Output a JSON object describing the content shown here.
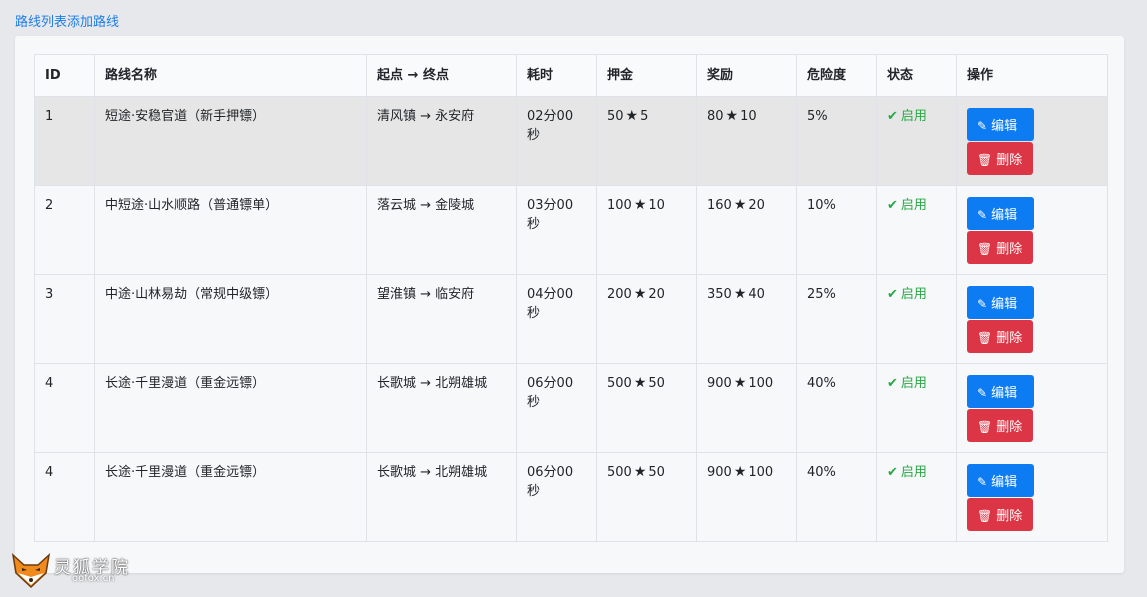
{
  "nav": {
    "link_list": "路线列表",
    "link_add": "添加路线"
  },
  "table": {
    "headers": {
      "id": "ID",
      "name": "路线名称",
      "route": "起点 → 终点",
      "duration": "耗时",
      "deposit": "押金",
      "reward": "奖励",
      "risk": "危险度",
      "status": "状态",
      "actions": "操作"
    },
    "rows": [
      {
        "id": "1",
        "name": "短途·安稳官道（新手押镖）",
        "route": "清风镇 → 永安府",
        "duration": "02分00秒",
        "deposit": "50",
        "deposit_stars": "5",
        "reward": "80",
        "reward_stars": "10",
        "risk": "5%",
        "status": "启用"
      },
      {
        "id": "2",
        "name": "中短途·山水顺路（普通镖单）",
        "route": "落云城 → 金陵城",
        "duration": "03分00秒",
        "deposit": "100",
        "deposit_stars": "10",
        "reward": "160",
        "reward_stars": "20",
        "risk": "10%",
        "status": "启用"
      },
      {
        "id": "3",
        "name": "中途·山林易劫（常规中级镖）",
        "route": "望淮镇 → 临安府",
        "duration": "04分00秒",
        "deposit": "200",
        "deposit_stars": "20",
        "reward": "350",
        "reward_stars": "40",
        "risk": "25%",
        "status": "启用"
      },
      {
        "id": "4",
        "name": "长途·千里漫道（重金远镖）",
        "route": "长歌城 → 北朔雄城",
        "duration": "06分00秒",
        "deposit": "500",
        "deposit_stars": "50",
        "reward": "900",
        "reward_stars": "100",
        "risk": "40%",
        "status": "启用"
      },
      {
        "id": "4",
        "name": "长途·千里漫道（重金远镖）",
        "route": "长歌城 → 北朔雄城",
        "duration": "06分00秒",
        "deposit": "500",
        "deposit_stars": "50",
        "reward": "900",
        "reward_stars": "100",
        "risk": "40%",
        "status": "启用"
      }
    ],
    "edit_label": "编辑",
    "delete_label": "删除"
  },
  "icons": {
    "star": "star-icon",
    "check": "check-icon",
    "edit": "pencil-icon",
    "delete": "trash-icon"
  },
  "watermark": {
    "cn": "灵狐学院",
    "en": "oofox.cn"
  },
  "colors": {
    "link": "#1e7ee8",
    "edit_button": "#0d7cf2",
    "delete_button": "#dc3545",
    "status_enabled": "#28a745",
    "highlight_row": "#e6e6e6"
  }
}
